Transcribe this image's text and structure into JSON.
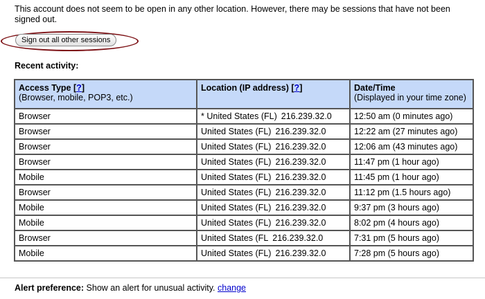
{
  "intro_text": "This account does not seem to be open in any other location. However, there may be sessions that have not been signed out.",
  "signout_button_label": "Sign out all other sessions",
  "recent_activity_label": "Recent activity:",
  "table": {
    "headers": {
      "access_type": {
        "title": "Access Type",
        "help_open": "[",
        "help_link": "?",
        "help_close": "]",
        "subtitle": "(Browser, mobile, POP3, etc.)"
      },
      "location": {
        "title": "Location (IP address)",
        "help_open": "[",
        "help_link": "?",
        "help_close": "]"
      },
      "datetime": {
        "title": "Date/Time",
        "subtitle": "(Displayed in your time zone)"
      }
    },
    "rows": [
      {
        "access": "Browser",
        "location": "* United States (FL)",
        "ip": "216.239.32.0",
        "time": "12:50 am (0 minutes ago)"
      },
      {
        "access": "Browser",
        "location": "United States (FL)",
        "ip": "216.239.32.0",
        "time": "12:22 am (27 minutes ago)"
      },
      {
        "access": "Browser",
        "location": "United States (FL)",
        "ip": "216.239.32.0",
        "time": "12:06 am (43 minutes ago)"
      },
      {
        "access": "Browser",
        "location": "United States (FL)",
        "ip": "216.239.32.0",
        "time": "11:47 pm (1 hour ago)"
      },
      {
        "access": "Mobile",
        "location": "United States (FL)",
        "ip": "216.239.32.0",
        "time": "11:45 pm (1 hour ago)"
      },
      {
        "access": "Browser",
        "location": "United States (FL)",
        "ip": "216.239.32.0",
        "time": "11:12 pm (1.5 hours ago)"
      },
      {
        "access": "Mobile",
        "location": "United States (FL)",
        "ip": "216.239.32.0",
        "time": "9:37 pm (3 hours ago)"
      },
      {
        "access": "Mobile",
        "location": "United States (FL)",
        "ip": "216.239.32.0",
        "time": "8:02 pm (4 hours ago)"
      },
      {
        "access": "Browser",
        "location": "United States (FL",
        "ip": "216.239.32.0",
        "time": "7:31 pm (5 hours ago)"
      },
      {
        "access": "Mobile",
        "location": "United States (FL)",
        "ip": "216.239.32.0",
        "time": "7:28 pm (5 hours ago)"
      }
    ]
  },
  "alert": {
    "label": "Alert preference:",
    "text": "Show an alert for unusual activity.",
    "link": "change"
  },
  "colors": {
    "header_bg": "#c5d9f9",
    "link": "#0000cc",
    "highlight_oval": "#7d1216",
    "table_border": "#555555"
  }
}
